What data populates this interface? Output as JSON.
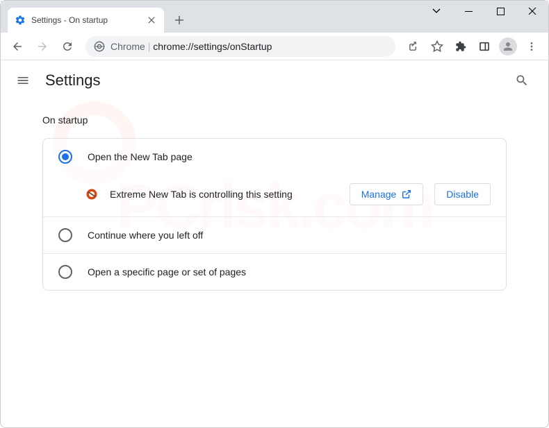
{
  "tab": {
    "title": "Settings - On startup"
  },
  "omnibox": {
    "prefix": "Chrome",
    "url": "chrome://settings/onStartup"
  },
  "header": {
    "title": "Settings"
  },
  "section": {
    "title": "On startup",
    "options": [
      "Open the New Tab page",
      "Continue where you left off",
      "Open a specific page or set of pages"
    ],
    "extension": {
      "text": "Extreme New Tab is controlling this setting",
      "manage_label": "Manage",
      "disable_label": "Disable"
    }
  }
}
